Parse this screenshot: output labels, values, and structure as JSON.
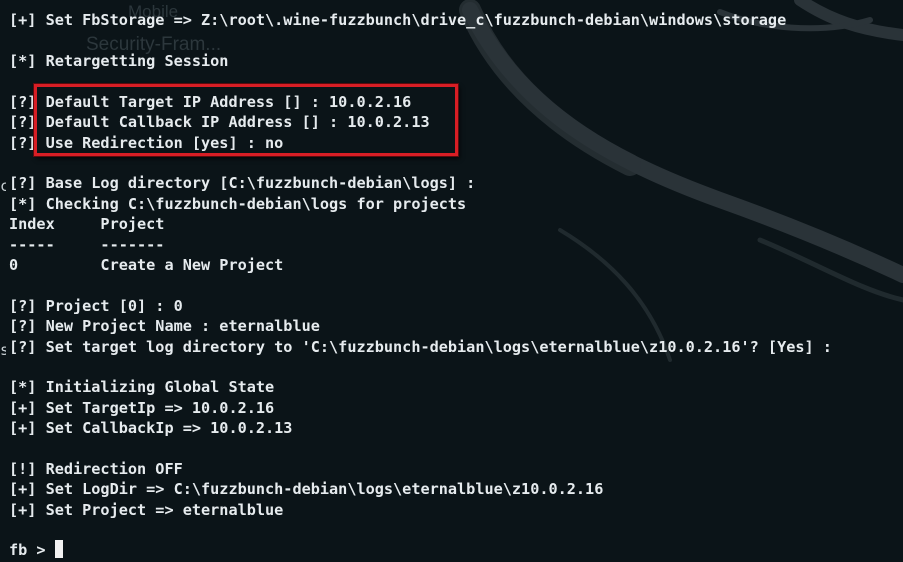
{
  "background": {
    "color": "#0b1418",
    "swirl_color": "#2a3338",
    "ghost_text_1": "Mobile",
    "ghost_text_2": "Security-Fram..."
  },
  "highlight": {
    "color": "#d81e25"
  },
  "terminal": {
    "lines": [
      "[+] Set FbStorage => Z:\\root\\.wine-fuzzbunch\\drive_c\\fuzzbunch-debian\\windows\\storage",
      "",
      "[*] Retargetting Session",
      "",
      "[?] Default Target IP Address [] : 10.0.2.16",
      "[?] Default Callback IP Address [] : 10.0.2.13",
      "[?] Use Redirection [yes] : no",
      "",
      "[?] Base Log directory [C:\\fuzzbunch-debian\\logs] :",
      "[*] Checking C:\\fuzzbunch-debian\\logs for projects",
      "Index     Project",
      "-----     -------",
      "0         Create a New Project",
      "",
      "[?] Project [0] : 0",
      "[?] New Project Name : eternalblue",
      "[?] Set target log directory to 'C:\\fuzzbunch-debian\\logs\\eternalblue\\z10.0.2.16'? [Yes] :",
      "",
      "[*] Initializing Global State",
      "[+] Set TargetIp => 10.0.2.16",
      "[+] Set CallbackIp => 10.0.2.13",
      "",
      "[!] Redirection OFF",
      "[+] Set LogDir => C:\\fuzzbunch-debian\\logs\\eternalblue\\z10.0.2.16",
      "[+] Set Project => eternalblue",
      ""
    ],
    "prompt": "fb > ",
    "edge_marks": [
      "c",
      "s"
    ]
  }
}
